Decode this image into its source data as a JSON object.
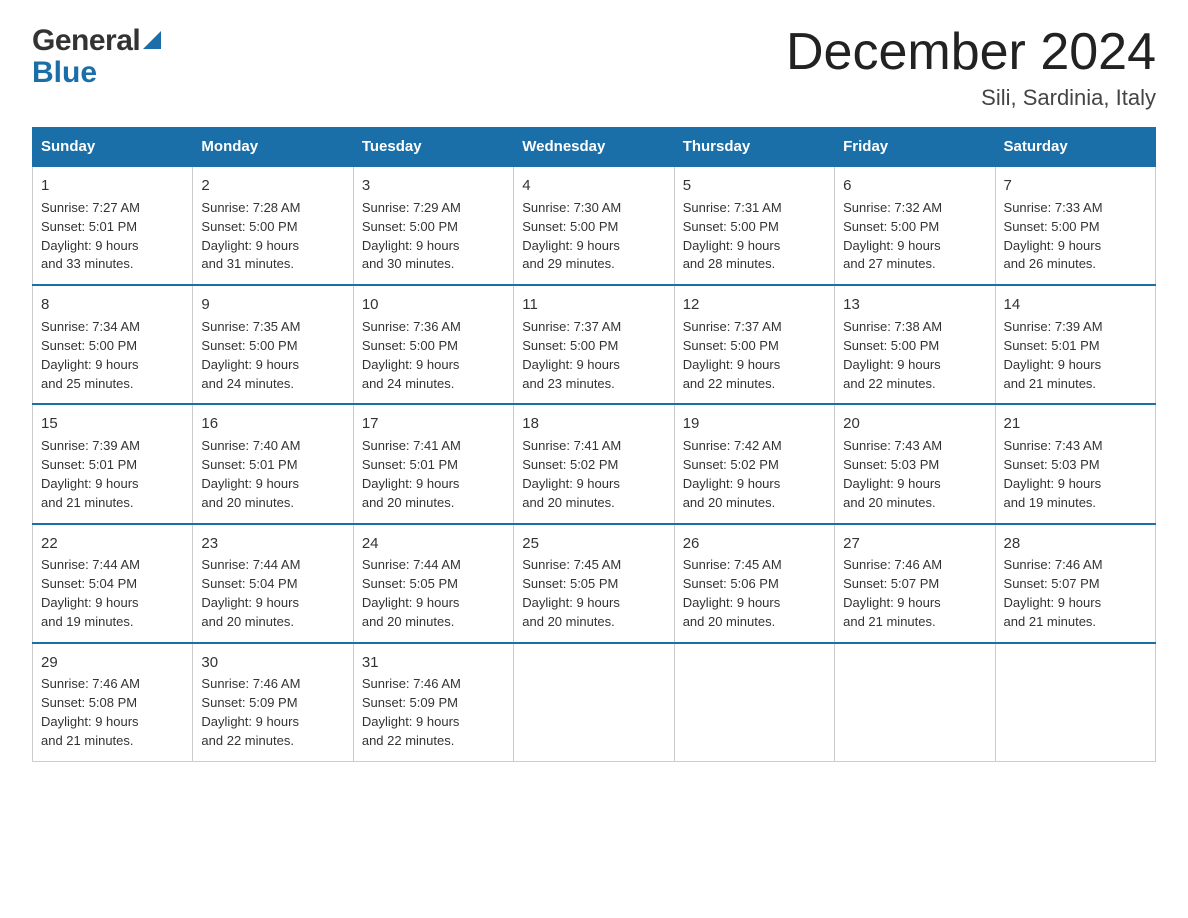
{
  "header": {
    "logo_general": "General",
    "logo_blue": "Blue",
    "title": "December 2024",
    "subtitle": "Sili, Sardinia, Italy"
  },
  "columns": [
    "Sunday",
    "Monday",
    "Tuesday",
    "Wednesday",
    "Thursday",
    "Friday",
    "Saturday"
  ],
  "weeks": [
    [
      {
        "day": "1",
        "sunrise": "Sunrise: 7:27 AM",
        "sunset": "Sunset: 5:01 PM",
        "daylight": "Daylight: 9 hours",
        "daylight2": "and 33 minutes."
      },
      {
        "day": "2",
        "sunrise": "Sunrise: 7:28 AM",
        "sunset": "Sunset: 5:00 PM",
        "daylight": "Daylight: 9 hours",
        "daylight2": "and 31 minutes."
      },
      {
        "day": "3",
        "sunrise": "Sunrise: 7:29 AM",
        "sunset": "Sunset: 5:00 PM",
        "daylight": "Daylight: 9 hours",
        "daylight2": "and 30 minutes."
      },
      {
        "day": "4",
        "sunrise": "Sunrise: 7:30 AM",
        "sunset": "Sunset: 5:00 PM",
        "daylight": "Daylight: 9 hours",
        "daylight2": "and 29 minutes."
      },
      {
        "day": "5",
        "sunrise": "Sunrise: 7:31 AM",
        "sunset": "Sunset: 5:00 PM",
        "daylight": "Daylight: 9 hours",
        "daylight2": "and 28 minutes."
      },
      {
        "day": "6",
        "sunrise": "Sunrise: 7:32 AM",
        "sunset": "Sunset: 5:00 PM",
        "daylight": "Daylight: 9 hours",
        "daylight2": "and 27 minutes."
      },
      {
        "day": "7",
        "sunrise": "Sunrise: 7:33 AM",
        "sunset": "Sunset: 5:00 PM",
        "daylight": "Daylight: 9 hours",
        "daylight2": "and 26 minutes."
      }
    ],
    [
      {
        "day": "8",
        "sunrise": "Sunrise: 7:34 AM",
        "sunset": "Sunset: 5:00 PM",
        "daylight": "Daylight: 9 hours",
        "daylight2": "and 25 minutes."
      },
      {
        "day": "9",
        "sunrise": "Sunrise: 7:35 AM",
        "sunset": "Sunset: 5:00 PM",
        "daylight": "Daylight: 9 hours",
        "daylight2": "and 24 minutes."
      },
      {
        "day": "10",
        "sunrise": "Sunrise: 7:36 AM",
        "sunset": "Sunset: 5:00 PM",
        "daylight": "Daylight: 9 hours",
        "daylight2": "and 24 minutes."
      },
      {
        "day": "11",
        "sunrise": "Sunrise: 7:37 AM",
        "sunset": "Sunset: 5:00 PM",
        "daylight": "Daylight: 9 hours",
        "daylight2": "and 23 minutes."
      },
      {
        "day": "12",
        "sunrise": "Sunrise: 7:37 AM",
        "sunset": "Sunset: 5:00 PM",
        "daylight": "Daylight: 9 hours",
        "daylight2": "and 22 minutes."
      },
      {
        "day": "13",
        "sunrise": "Sunrise: 7:38 AM",
        "sunset": "Sunset: 5:00 PM",
        "daylight": "Daylight: 9 hours",
        "daylight2": "and 22 minutes."
      },
      {
        "day": "14",
        "sunrise": "Sunrise: 7:39 AM",
        "sunset": "Sunset: 5:01 PM",
        "daylight": "Daylight: 9 hours",
        "daylight2": "and 21 minutes."
      }
    ],
    [
      {
        "day": "15",
        "sunrise": "Sunrise: 7:39 AM",
        "sunset": "Sunset: 5:01 PM",
        "daylight": "Daylight: 9 hours",
        "daylight2": "and 21 minutes."
      },
      {
        "day": "16",
        "sunrise": "Sunrise: 7:40 AM",
        "sunset": "Sunset: 5:01 PM",
        "daylight": "Daylight: 9 hours",
        "daylight2": "and 20 minutes."
      },
      {
        "day": "17",
        "sunrise": "Sunrise: 7:41 AM",
        "sunset": "Sunset: 5:01 PM",
        "daylight": "Daylight: 9 hours",
        "daylight2": "and 20 minutes."
      },
      {
        "day": "18",
        "sunrise": "Sunrise: 7:41 AM",
        "sunset": "Sunset: 5:02 PM",
        "daylight": "Daylight: 9 hours",
        "daylight2": "and 20 minutes."
      },
      {
        "day": "19",
        "sunrise": "Sunrise: 7:42 AM",
        "sunset": "Sunset: 5:02 PM",
        "daylight": "Daylight: 9 hours",
        "daylight2": "and 20 minutes."
      },
      {
        "day": "20",
        "sunrise": "Sunrise: 7:43 AM",
        "sunset": "Sunset: 5:03 PM",
        "daylight": "Daylight: 9 hours",
        "daylight2": "and 20 minutes."
      },
      {
        "day": "21",
        "sunrise": "Sunrise: 7:43 AM",
        "sunset": "Sunset: 5:03 PM",
        "daylight": "Daylight: 9 hours",
        "daylight2": "and 19 minutes."
      }
    ],
    [
      {
        "day": "22",
        "sunrise": "Sunrise: 7:44 AM",
        "sunset": "Sunset: 5:04 PM",
        "daylight": "Daylight: 9 hours",
        "daylight2": "and 19 minutes."
      },
      {
        "day": "23",
        "sunrise": "Sunrise: 7:44 AM",
        "sunset": "Sunset: 5:04 PM",
        "daylight": "Daylight: 9 hours",
        "daylight2": "and 20 minutes."
      },
      {
        "day": "24",
        "sunrise": "Sunrise: 7:44 AM",
        "sunset": "Sunset: 5:05 PM",
        "daylight": "Daylight: 9 hours",
        "daylight2": "and 20 minutes."
      },
      {
        "day": "25",
        "sunrise": "Sunrise: 7:45 AM",
        "sunset": "Sunset: 5:05 PM",
        "daylight": "Daylight: 9 hours",
        "daylight2": "and 20 minutes."
      },
      {
        "day": "26",
        "sunrise": "Sunrise: 7:45 AM",
        "sunset": "Sunset: 5:06 PM",
        "daylight": "Daylight: 9 hours",
        "daylight2": "and 20 minutes."
      },
      {
        "day": "27",
        "sunrise": "Sunrise: 7:46 AM",
        "sunset": "Sunset: 5:07 PM",
        "daylight": "Daylight: 9 hours",
        "daylight2": "and 21 minutes."
      },
      {
        "day": "28",
        "sunrise": "Sunrise: 7:46 AM",
        "sunset": "Sunset: 5:07 PM",
        "daylight": "Daylight: 9 hours",
        "daylight2": "and 21 minutes."
      }
    ],
    [
      {
        "day": "29",
        "sunrise": "Sunrise: 7:46 AM",
        "sunset": "Sunset: 5:08 PM",
        "daylight": "Daylight: 9 hours",
        "daylight2": "and 21 minutes."
      },
      {
        "day": "30",
        "sunrise": "Sunrise: 7:46 AM",
        "sunset": "Sunset: 5:09 PM",
        "daylight": "Daylight: 9 hours",
        "daylight2": "and 22 minutes."
      },
      {
        "day": "31",
        "sunrise": "Sunrise: 7:46 AM",
        "sunset": "Sunset: 5:09 PM",
        "daylight": "Daylight: 9 hours",
        "daylight2": "and 22 minutes."
      },
      {
        "day": "",
        "sunrise": "",
        "sunset": "",
        "daylight": "",
        "daylight2": ""
      },
      {
        "day": "",
        "sunrise": "",
        "sunset": "",
        "daylight": "",
        "daylight2": ""
      },
      {
        "day": "",
        "sunrise": "",
        "sunset": "",
        "daylight": "",
        "daylight2": ""
      },
      {
        "day": "",
        "sunrise": "",
        "sunset": "",
        "daylight": "",
        "daylight2": ""
      }
    ]
  ]
}
